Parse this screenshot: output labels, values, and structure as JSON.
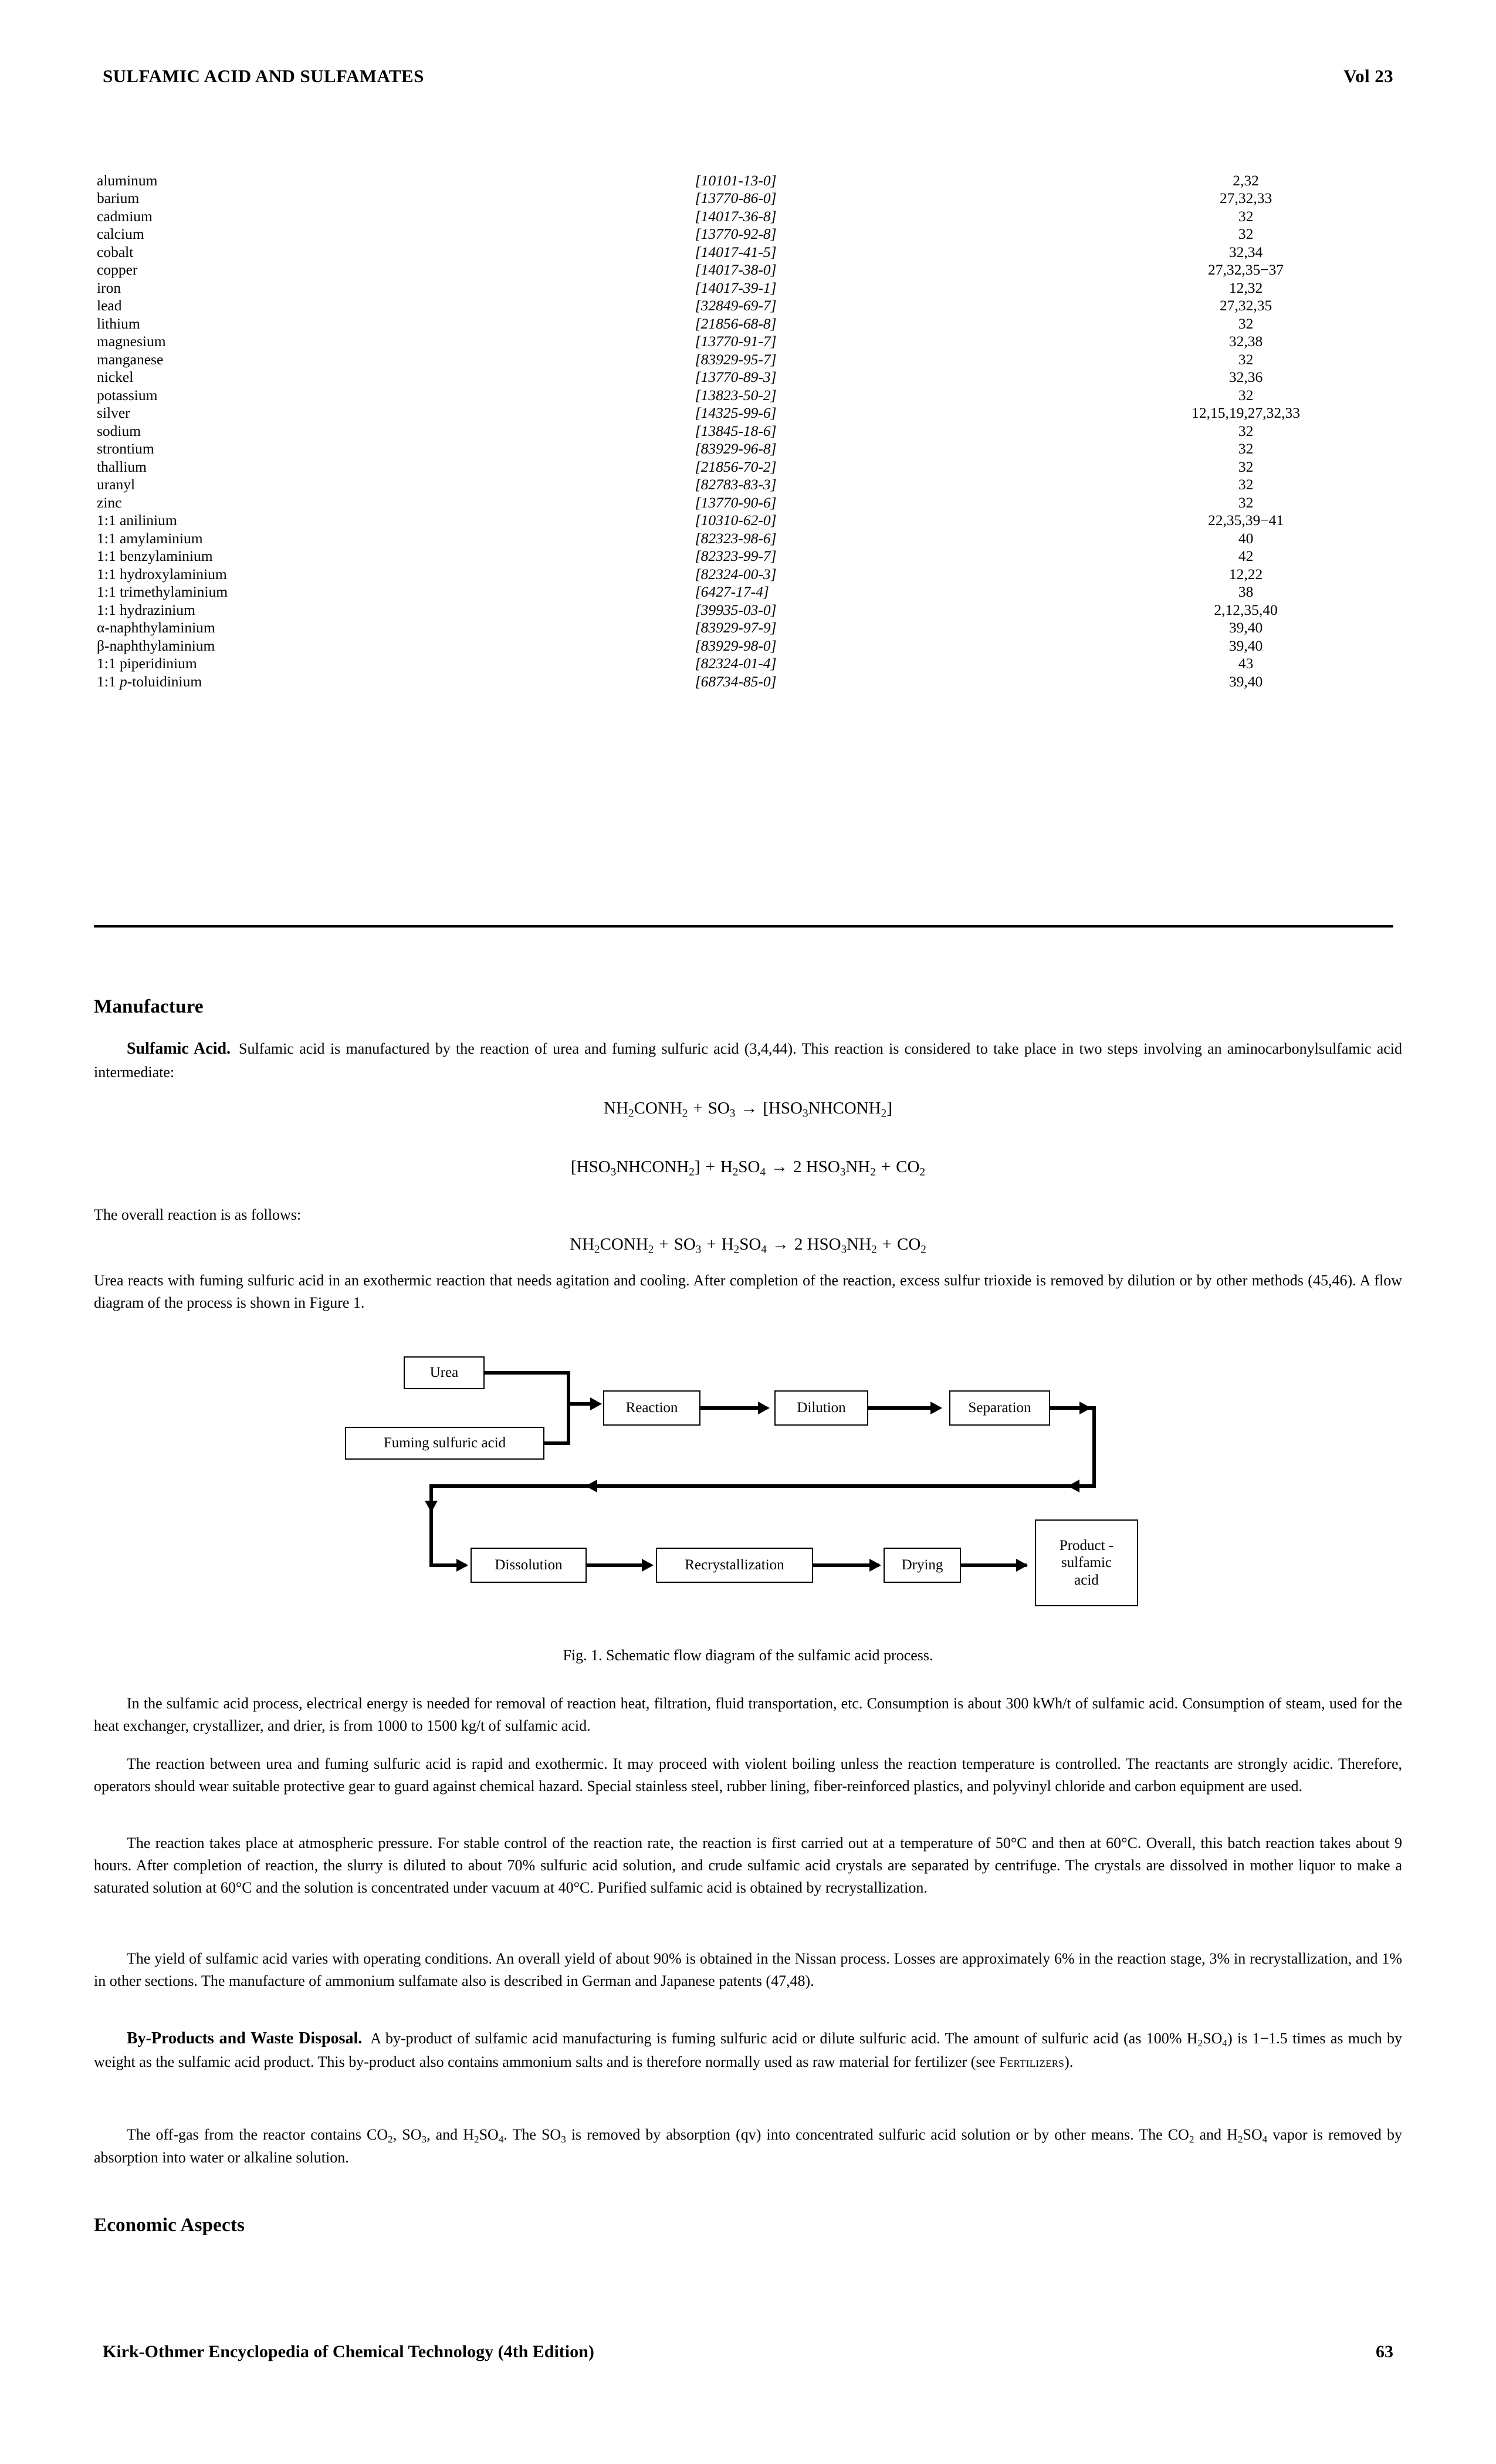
{
  "running_head": {
    "title": "SULFAMIC ACID AND SULFAMATES",
    "volume": "Vol 23"
  },
  "table": {
    "rows": [
      {
        "name": "aluminum",
        "cas": "[10101-13-0]",
        "refs": "2,32"
      },
      {
        "name": "barium",
        "cas": "[13770-86-0]",
        "refs": "27,32,33"
      },
      {
        "name": "cadmium",
        "cas": "[14017-36-8]",
        "refs": "32"
      },
      {
        "name": "calcium",
        "cas": "[13770-92-8]",
        "refs": "32"
      },
      {
        "name": "cobalt",
        "cas": "[14017-41-5]",
        "refs": "32,34"
      },
      {
        "name": "copper",
        "cas": "[14017-38-0]",
        "refs": "27,32,35−37"
      },
      {
        "name": "iron",
        "cas": "[14017-39-1]",
        "refs": "12,32"
      },
      {
        "name": "lead",
        "cas": "[32849-69-7]",
        "refs": "27,32,35"
      },
      {
        "name": "lithium",
        "cas": "[21856-68-8]",
        "refs": "32"
      },
      {
        "name": "magnesium",
        "cas": "[13770-91-7]",
        "refs": "32,38"
      },
      {
        "name": "manganese",
        "cas": "[83929-95-7]",
        "refs": "32"
      },
      {
        "name": "nickel",
        "cas": "[13770-89-3]",
        "refs": "32,36"
      },
      {
        "name": "potassium",
        "cas": "[13823-50-2]",
        "refs": "32"
      },
      {
        "name": "silver",
        "cas": "[14325-99-6]",
        "refs": "12,15,19,27,32,33"
      },
      {
        "name": "sodium",
        "cas": "[13845-18-6]",
        "refs": "32"
      },
      {
        "name": "strontium",
        "cas": "[83929-96-8]",
        "refs": "32"
      },
      {
        "name": "thallium",
        "cas": "[21856-70-2]",
        "refs": "32"
      },
      {
        "name": "uranyl",
        "cas": "[82783-83-3]",
        "refs": "32"
      },
      {
        "name": "zinc",
        "cas": "[13770-90-6]",
        "refs": "32"
      },
      {
        "name": "1:1 anilinium",
        "cas": "[10310-62-0]",
        "refs": "22,35,39−41"
      },
      {
        "name": "1:1 amylaminium",
        "cas": "[82323-98-6]",
        "refs": "40"
      },
      {
        "name": "1:1 benzylaminium",
        "cas": "[82323-99-7]",
        "refs": "42"
      },
      {
        "name": "1:1 hydroxylaminium",
        "cas": "[82324-00-3]",
        "refs": "12,22"
      },
      {
        "name": "1:1 trimethylaminium",
        "cas": "[6427-17-4]",
        "refs": "38"
      },
      {
        "name": "1:1 hydrazinium",
        "cas": "[39935-03-0]",
        "refs": "2,12,35,40"
      },
      {
        "name": "α-naphthylaminium",
        "cas": "[83929-97-9]",
        "refs": "39,40"
      },
      {
        "name": "β-naphthylaminium",
        "cas": "[83929-98-0]",
        "refs": "39,40"
      },
      {
        "name": "1:1 piperidinium",
        "cas": "[82324-01-4]",
        "refs": "43"
      },
      {
        "name": "1:1 p-toluidinium",
        "cas": "[68734-85-0]",
        "refs": "39,40",
        "name_italic_part": "p"
      }
    ]
  },
  "headings": {
    "manufacture": "Manufacture",
    "economic_aspects": "Economic Aspects"
  },
  "paragraphs": {
    "sulfamic_acid_runin": "Sulfamic Acid.",
    "sulfamic_acid_body": "Sulfamic acid is manufactured by the reaction of urea and fuming sulfuric acid (3,4,44). This reaction is considered to take place in two steps involving an aminocarbonylsulfamic acid intermediate:",
    "overall_lead": "The overall reaction is as follows:",
    "urea_reacts": "Urea reacts with fuming sulfuric acid in an exothermic reaction that needs agitation and cooling. After completion of the reaction, excess sulfur trioxide is removed by dilution or by other methods (45,46). A flow diagram of the process is shown in Figure 1.",
    "process_energy": "In the sulfamic acid process, electrical energy is needed for removal of reaction heat, filtration, fluid transportation, etc. Consumption is about 300 kWh/t of sulfamic acid. Consumption of steam, used for the heat exchanger, crystallizer, and drier, is from 1000 to 1500 kg/t of sulfamic acid.",
    "reaction_urea": "The reaction between urea and fuming sulfuric acid is rapid and exothermic. It may proceed with violent boiling unless the reaction temperature is controlled. The reactants are strongly acidic. Therefore, operators should wear suitable protective gear to guard against chemical hazard. Special stainless steel, rubber lining, fiber-reinforced plastics, and polyvinyl chloride and carbon equipment are used.",
    "atmospheric": "The reaction takes place at atmospheric pressure. For stable control of the reaction rate, the reaction is first carried out at a temperature of 50°C and then at 60°C. Overall, this batch reaction takes about 9 hours. After completion of reaction, the slurry is diluted to about 70% sulfuric acid solution, and crude sulfamic acid crystals are separated by centrifuge. The crystals are dissolved in mother liquor to make a saturated solution at 60°C and the solution is concentrated under vacuum at 40°C. Purified sulfamic acid is obtained by recrystallization.",
    "yield": "The yield of sulfamic acid varies with operating conditions. An overall yield of about 90% is obtained in the Nissan process. Losses are approximately 6% in the reaction stage, 3% in recrystallization, and 1% in other sections. The manufacture of ammonium sulfamate also is described in German and Japanese patents (47,48).",
    "byproducts_runin": "By-Products and Waste Disposal.",
    "byproducts_body_1": "A by-product of sulfamic acid manufacturing is fuming sulfuric acid or dilute sulfuric acid. The amount of sulfuric acid (as 100% H",
    "byproducts_body_2": ") is 1−1.5 times as much by weight as the sulfamic acid product. This by-product also contains ammonium salts and is therefore normally used as raw material for fertilizer (see ",
    "byproducts_crossref": "Fertilizers",
    "byproducts_body_3": ").",
    "offgas_1": "The off-gas from the reactor contains CO",
    "offgas_2": ", SO",
    "offgas_3": ", and H",
    "offgas_4": ". The SO",
    "offgas_5": " is removed by absorption (qv) into concentrated sulfuric acid solution or by other means. The CO",
    "offgas_6": " and H",
    "offgas_7": " vapor is removed by absorption into water or alkaline solution."
  },
  "equations": {
    "eq1": {
      "parts": [
        "NH",
        "2",
        "CONH",
        "2",
        " + SO",
        "3",
        " → [HSO",
        "3",
        "NHCONH",
        "2",
        "]"
      ]
    },
    "eq2": {
      "parts": [
        "[HSO",
        "3",
        "NHCONH",
        "2",
        "] + H",
        "2",
        "SO",
        "4",
        " → 2 HSO",
        "3",
        "NH",
        "2",
        " + CO",
        "2"
      ]
    },
    "eq3": {
      "parts": [
        "NH",
        "2",
        "CONH",
        "2",
        " + SO",
        "3",
        " + H",
        "2",
        "SO",
        "4",
        " → 2 HSO",
        "3",
        "NH",
        "2",
        " + CO",
        "2"
      ]
    }
  },
  "figure": {
    "caption": "Fig. 1. Schematic flow diagram of the sulfamic acid process.",
    "boxes": {
      "urea": "Urea",
      "fuming_sulfuric_acid": "Fuming sulfuric acid",
      "reaction": "Reaction",
      "dilution": "Dilution",
      "separation": "Separation",
      "dissolution": "Dissolution",
      "recrystallization": "Recrystallization",
      "drying": "Drying",
      "product": "Product -\nsulfamic\nacid"
    }
  },
  "footer": {
    "source": "Kirk-Othmer Encyclopedia of Chemical Technology (4th Edition)",
    "page": "63"
  }
}
